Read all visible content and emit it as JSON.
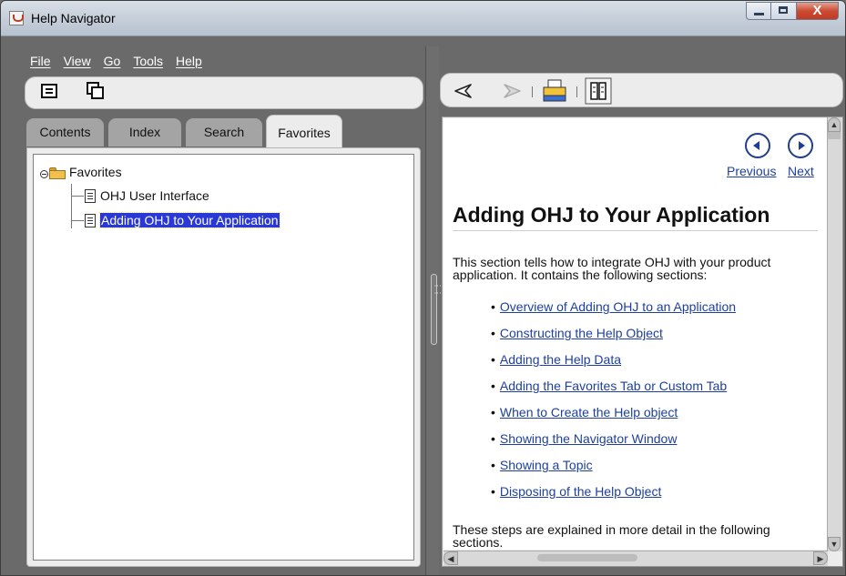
{
  "window": {
    "title": "Help Navigator"
  },
  "menu": [
    "File",
    "View",
    "Go",
    "Tools",
    "Help"
  ],
  "left_toolbar": {
    "buttons": [
      "document-icon",
      "split-window-icon"
    ]
  },
  "right_toolbar": {
    "buttons": [
      "back-arrow-icon",
      "forward-arrow-icon",
      "print-icon",
      "page-layout-icon"
    ]
  },
  "tabs": [
    "Contents",
    "Index",
    "Search",
    "Favorites"
  ],
  "active_tab": "Favorites",
  "tree": {
    "root": "Favorites",
    "items": [
      "OHJ User Interface",
      "Adding OHJ to Your Application"
    ],
    "selected_item": "Adding OHJ to Your Application"
  },
  "topic": {
    "nav": {
      "previous": "Previous",
      "next": "Next"
    },
    "heading": "Adding OHJ to Your Application",
    "intro": "This section tells how to integrate OHJ with your product application. It contains the following sections:",
    "links": [
      "Overview of Adding OHJ to an Application",
      "Constructing the Help Object",
      "Adding the Help Data",
      "Adding the Favorites Tab or Custom Tab",
      "When to Create the Help object",
      "Showing the Navigator Window",
      "Showing a Topic",
      "Disposing of the Help Object"
    ],
    "outro": "These steps are explained in more detail in the following sections."
  },
  "colors": {
    "selection": "#2a39d6",
    "link": "#1d3f9f",
    "panel": "#ececec",
    "frame": "#6e6e6e"
  }
}
